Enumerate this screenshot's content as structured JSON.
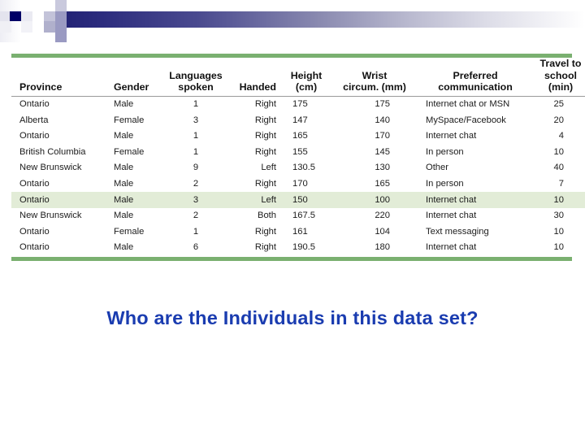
{
  "slide": {
    "decoration": {
      "gradient_start_color": "#1b1b6e",
      "gradient_end_color": "#ffffff",
      "accent_square_color": "#000066"
    },
    "question": "Who are the Individuals in this data set?",
    "question_color": "#1a3cb0"
  },
  "table": {
    "rule_color": "#7ab070",
    "highlight_color": "#e2ecd7",
    "highlighted_row_index": 6,
    "columns": [
      {
        "key": "province",
        "line1": "",
        "line2": "Province"
      },
      {
        "key": "gender",
        "line1": "",
        "line2": "Gender"
      },
      {
        "key": "languages",
        "line1": "Languages",
        "line2": "spoken"
      },
      {
        "key": "handed",
        "line1": "",
        "line2": "Handed"
      },
      {
        "key": "height",
        "line1": "Height",
        "line2": "(cm)"
      },
      {
        "key": "wrist",
        "line1": "Wrist",
        "line2": "circum. (mm)"
      },
      {
        "key": "communication",
        "line1": "Preferred",
        "line2": "communication"
      },
      {
        "key": "travel",
        "line1": "Travel to",
        "line2": "school (min)"
      }
    ],
    "rows": [
      {
        "province": "Ontario",
        "gender": "Male",
        "languages": "1",
        "handed": "Right",
        "height": "175",
        "wrist": "175",
        "communication": "Internet chat or MSN",
        "travel": "25"
      },
      {
        "province": "Alberta",
        "gender": "Female",
        "languages": "3",
        "handed": "Right",
        "height": "147",
        "wrist": "140",
        "communication": "MySpace/Facebook",
        "travel": "20"
      },
      {
        "province": "Ontario",
        "gender": "Male",
        "languages": "1",
        "handed": "Right",
        "height": "165",
        "wrist": "170",
        "communication": "Internet chat",
        "travel": "4"
      },
      {
        "province": "British Columbia",
        "gender": "Female",
        "languages": "1",
        "handed": "Right",
        "height": "155",
        "wrist": "145",
        "communication": "In person",
        "travel": "10"
      },
      {
        "province": "New Brunswick",
        "gender": "Male",
        "languages": "9",
        "handed": "Left",
        "height": "130.5",
        "wrist": "130",
        "communication": "Other",
        "travel": "40"
      },
      {
        "province": "Ontario",
        "gender": "Male",
        "languages": "2",
        "handed": "Right",
        "height": "170",
        "wrist": "165",
        "communication": "In person",
        "travel": "7"
      },
      {
        "province": "Ontario",
        "gender": "Male",
        "languages": "3",
        "handed": "Left",
        "height": "150",
        "wrist": "100",
        "communication": "Internet chat",
        "travel": "10"
      },
      {
        "province": "New Brunswick",
        "gender": "Male",
        "languages": "2",
        "handed": "Both",
        "height": "167.5",
        "wrist": "220",
        "communication": "Internet chat",
        "travel": "30"
      },
      {
        "province": "Ontario",
        "gender": "Female",
        "languages": "1",
        "handed": "Right",
        "height": "161",
        "wrist": "104",
        "communication": "Text messaging",
        "travel": "10"
      },
      {
        "province": "Ontario",
        "gender": "Male",
        "languages": "6",
        "handed": "Right",
        "height": "190.5",
        "wrist": "180",
        "communication": "Internet chat",
        "travel": "10"
      }
    ]
  }
}
